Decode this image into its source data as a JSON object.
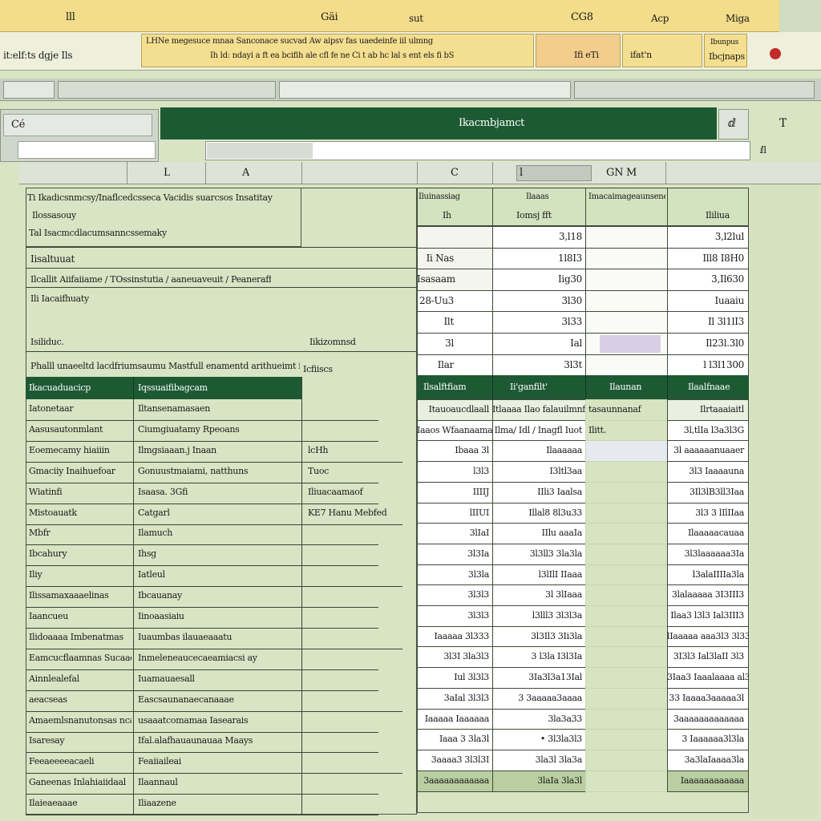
{
  "top": {
    "tabs": [
      "lll",
      "Gäi",
      "sut",
      "CG8",
      "Acp",
      "Miga"
    ]
  },
  "ribbon": {
    "left_label": "it:elf:ts dgje Ils",
    "line1": "LHNe megesuce mnaa Sanconace sucvad Aw aipsv fas uaedeinfe iil ulmng",
    "line2": "Ih ld: ndayi a ft ea bcifih ale cfl fe ne Ci t ab hc lal s ent els fi bS",
    "cell_a": "Ifi eTi",
    "cell_b": "ifat'n",
    "cell_c": "Ibunpus",
    "cell_c2": "Ibcjnaps"
  },
  "formula": {
    "namebox": "Cé",
    "banner": "Ikacmbjamct",
    "right_icon": "ⅆ",
    "right_label": "T",
    "sub_right": "ⅈl"
  },
  "col_headers": [
    "L",
    "A",
    "C",
    "l",
    "GN M"
  ],
  "left_block": {
    "header_lines": [
      "Ti Ikadicsnmcsy/Inaflcedcsseca Vacidis suarcsos Insatitay",
      "Ilossasouy",
      "Tal Isacmcdlacumsanncssemaky"
    ],
    "label1": "Iisaltuuat",
    "desc1": "Ilcallit Aiifaiiame / TOssinstutia / aaneuaveuit / Peaneraffs",
    "desc2": "Ili Iacaifhuaty",
    "label2": "Isiliduc.",
    "label2_val": "Iikizomnsd",
    "footer_line": "Phalll unaeeltd lacdfriumsaumu Mastfull enamentd arithueimt inced",
    "footer_tag": "Icfiiscs",
    "table_headers": [
      "Ikacuaduacicp",
      "Iqssuaifibagcam"
    ],
    "rows": [
      [
        "Iatonetaar",
        "Iltansenamasaen",
        ""
      ],
      [
        "Aasusautonmlant",
        "Ciumgiuatamy Rpeoans",
        ""
      ],
      [
        "Eoemecamy hiaiiin",
        "Ilmgsiaaan.j Inaan",
        "lcHh"
      ],
      [
        "Gmaciiy Inaihuefoar",
        "Gonuustmaiami, natthuns",
        "Tuoc"
      ],
      [
        "Wiatinfi",
        "Isaasa. 3Gfi",
        "Iliuacaamaof"
      ],
      [
        "Mistoauatk",
        "Catgarl",
        "KE7 Hanu Mebfed"
      ],
      [
        "Mbfr",
        "Ilamuch",
        ""
      ],
      [
        "Ibcahury",
        "Ihsg",
        ""
      ],
      [
        "Iliy",
        "Iatleul",
        ""
      ],
      [
        "Ilissamaxaaaelinas",
        "Ibcauanay",
        ""
      ],
      [
        "Iaancueu",
        "Iinoaasiaiu",
        ""
      ],
      [
        "Ilidoaaaa Imbenatmas",
        "Iuaumbas ilauaeaaatu",
        ""
      ],
      [
        "Eamcucflaamnas Sucaacrana",
        "Inmeleneaucecaeamiacsi ay",
        ""
      ],
      [
        "Ainnlealefal",
        "Iuamauaesall",
        ""
      ],
      [
        "aeacseas",
        "Eascsaunanaecanaaae",
        ""
      ],
      [
        "Amaemlsnanutonsas ncaeas",
        "usaaatcomamaa Iasearais",
        ""
      ],
      [
        "Isaresay",
        "Ifal.alafhauaunauaa Maays",
        ""
      ],
      [
        "Feeaeeeeacaeli",
        "Feaiiaileai",
        ""
      ],
      [
        "Ganeenas Inlahiaiidaal",
        "Ilaannaul",
        ""
      ],
      [
        "Ilaieaeaaae",
        "Iliaazene",
        ""
      ]
    ]
  },
  "right_block": {
    "head": [
      [
        "Iluinassiag",
        "Ilaaas",
        "Imacaimageaunsene",
        ""
      ],
      [
        "Ih",
        "Iomsj fft",
        "",
        "Ililiua"
      ]
    ],
    "top_rows": [
      [
        "",
        "3,l18",
        "",
        "3,l2lul"
      ],
      [
        "Ii Nas",
        "1l8I3",
        "",
        "Ill8 I8H0"
      ],
      [
        "Isasaam",
        "Iig30",
        "",
        "3,Il630"
      ],
      [
        "28-Uu3",
        "3l30",
        "",
        "Iuaaiu"
      ],
      [
        "Ilt",
        "3l33",
        "",
        "Il 3l1lI3"
      ],
      [
        "3l",
        "Ial",
        "",
        "Il23l.3l0"
      ],
      [
        "Ilar",
        "3l3t",
        "",
        "l l3l1300"
      ]
    ],
    "table_headers": [
      "Ilsalftfiam",
      "Ii'ganfilt'",
      "Ilaunan",
      "Ilaalfnaae"
    ],
    "rows": [
      [
        "Itauoaucdlaall",
        "Itlaaaa Ilao falauilmnfl",
        "tasaunnanaf",
        "Ilrtaaaiaitl"
      ],
      [
        "Iaaos Wfaanaamautl",
        "Ilma/ Idl / Inagfl Iuot",
        "Ilitt.",
        "3l,tlIa l3a3l3G"
      ],
      [
        "Ibaaa   3l",
        "Ilaaaaaa",
        "",
        "3l aaaaaanuaaer"
      ],
      [
        "l3l3",
        "I3ltl3aa",
        "",
        "3l3 Iaaaauna"
      ],
      [
        "IIIIJ",
        "IIli3 Iaalsa",
        "",
        "3Il3lB3ll3Iaa"
      ],
      [
        "lIIUI",
        "Illal8 8l3u33",
        "",
        "3l3 3 lIlIIaa"
      ],
      [
        "3lIaI",
        "IIlu aaaIa",
        "",
        "Ilaaaaacauaa"
      ],
      [
        "3l3Ia",
        "3l3ll3 3la3la",
        "",
        "3l3laaaaaa3Ia"
      ],
      [
        "3l3la",
        "l3lIlI IIaaa",
        "",
        "l3alaIIIIa3la"
      ],
      [
        "3l3l3",
        "3l 3lIaaa",
        "",
        "3lalaaaaa 3I3III3"
      ],
      [
        "3l3l3",
        "l3lll3 3l3l3a",
        "",
        "Ilaa3 l3l3 Ial3III3"
      ],
      [
        "Iaaaaa  3l333",
        "3l3Il3 3Ii3la",
        "",
        "lIaaaaa aaa3l3 3l33"
      ],
      [
        "3l3I   3la3l3",
        "3 l3la I3l3Ia",
        "",
        "3I3l3 Ial3laII 3l3"
      ],
      [
        "Iul   3l3l3",
        "3Ia3l3a13Ial",
        "",
        "3Iaa3 Iaaalaaaa al3"
      ],
      [
        "3aIal   3l3l3",
        "3 3aaaaa3aaaa",
        "",
        "33 Iaaaa3aaaaa3l"
      ],
      [
        "Iaaaaa Iaaaaaa",
        "3la3a33",
        "",
        "3aaaaaaaaaaaaa"
      ],
      [
        "Iaaa   3 3la3l",
        "• 3l3la3l3",
        "",
        "3 Iaaaaaa3l3la"
      ],
      [
        "3aaaa3 3l3l3I",
        "3la3l 3la3a",
        "",
        "3a3laIaaaa3la"
      ],
      [
        "3aaaaaaaaaaaa",
        "3laIa 3la3l",
        "",
        "Iaaaaaaaaaaaa"
      ]
    ]
  },
  "colors": {
    "green": "#1d5a34",
    "yellow": "#f1dc8c",
    "sheet": "#d9e4c4",
    "record": "#c22a2a"
  }
}
